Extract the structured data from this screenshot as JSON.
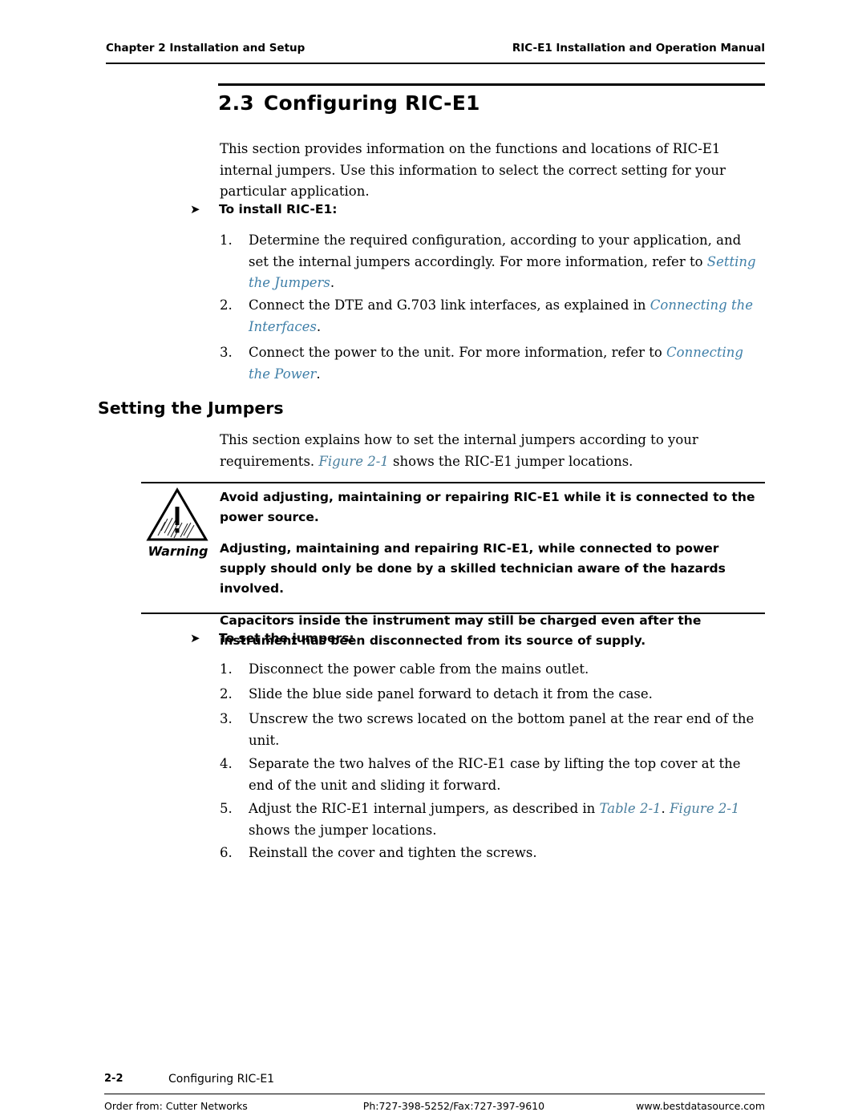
{
  "header": {
    "left": "Chapter 2  Installation and Setup",
    "right": "RIC-E1 Installation and Operation Manual"
  },
  "section": {
    "number": "2.3",
    "title": "Configuring RIC-E1",
    "intro": "This section provides information on the functions and locations of RIC-E1 internal jumpers. Use this information to select the correct setting for your particular application."
  },
  "install_proc": {
    "heading": "To install RIC-E1:",
    "arrow": "➤",
    "steps": [
      {
        "num": "1.",
        "text_before": "Determine the required configuration, according to your application, and set the internal jumpers accordingly. For more information, refer to ",
        "link": "Setting the Jumpers",
        "text_after": "."
      },
      {
        "num": "2.",
        "text_before": "Connect the DTE and G.703 link interfaces, as explained in ",
        "link": "Connecting the Interfaces",
        "text_after": "."
      },
      {
        "num": "3.",
        "text_before": "Connect the power to the unit. For more information, refer to ",
        "link": "Connecting the Power",
        "text_after": "."
      }
    ]
  },
  "subsection": {
    "title": "Setting the Jumpers",
    "intro_before": "This section explains how to set the internal jumpers according to your requirements. ",
    "intro_ref": "Figure 2-1",
    "intro_after": " shows the RIC-E1 jumper locations."
  },
  "warning": {
    "label": "Warning",
    "icon": "warning-triangle-icon",
    "paragraphs": [
      "Avoid adjusting, maintaining or repairing RIC-E1 while it is connected to the power source.",
      "Adjusting, maintaining and repairing RIC-E1, while connected to power supply should only be done by a skilled technician aware of the hazards involved.",
      "Capacitors inside the instrument may still be charged even after the instrument has been disconnected from its source of supply."
    ]
  },
  "jumpers_proc": {
    "heading": "To set the jumpers:",
    "arrow": "➤",
    "steps": [
      {
        "num": "1.",
        "text": "Disconnect the power cable from the mains outlet."
      },
      {
        "num": "2.",
        "text": "Slide the blue side panel forward to detach it from the case."
      },
      {
        "num": "3.",
        "text": "Unscrew the two screws located on the bottom panel at the rear end of the unit."
      },
      {
        "num": "4.",
        "text": "Separate the two halves of the RIC-E1 case by lifting the top cover at the end of the unit and sliding it forward."
      },
      {
        "num": "5.",
        "text_before": "Adjust the RIC-E1 internal jumpers, as described in ",
        "ref1": "Table 2-1",
        "mid": ". ",
        "ref2": "Figure 2-1",
        "text_after": " shows the jumper locations."
      },
      {
        "num": "6.",
        "text": "Reinstall the cover and tighten the screws."
      }
    ]
  },
  "footer": {
    "page": "2-2",
    "title": "Configuring RIC-E1",
    "order_from": "Order from: Cutter Networks",
    "phone": "Ph:727-398-5252/Fax:727-397-9610",
    "website": "www.bestdatasource.com"
  }
}
